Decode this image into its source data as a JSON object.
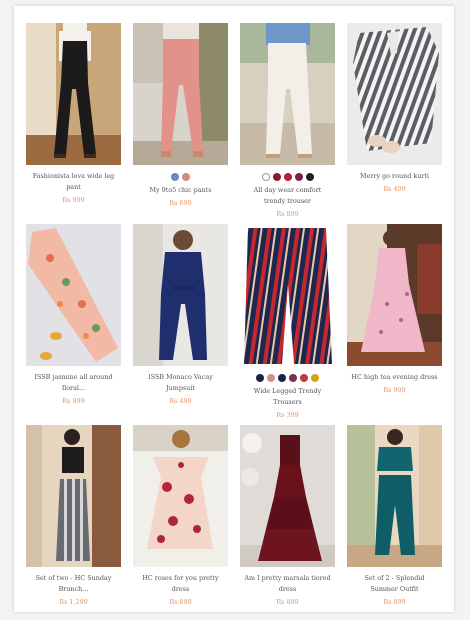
{
  "products": [
    {
      "name": "Fashionista leva wide leg pant",
      "price": "Rs 899",
      "swatches": []
    },
    {
      "name": "My 9to5 chic pants",
      "price": "Rs 699",
      "swatches": [
        "#6f86c6",
        "#cf8b7e"
      ]
    },
    {
      "name": "All day wear comfort trendy trouser",
      "price": "Rs 899",
      "swatches": [
        "#ffffff",
        "#8c1b2b",
        "#b3203a",
        "#7a1f4a",
        "#222222"
      ]
    },
    {
      "name": "Merry go round kurti",
      "price": "Rs 499",
      "swatches": []
    },
    {
      "name": "ISSB jasmine all around floral...",
      "price": "Rs 899",
      "swatches": []
    },
    {
      "name": "ISSB Monaco Vacay Jumpsuit",
      "price": "Rs 499",
      "swatches": []
    },
    {
      "name": "Wide Legged Trendy Trousers",
      "price": "Rs 399",
      "swatches": [
        "#1b2340",
        "#d98c8c",
        "#17254a",
        "#7a2f4a",
        "#c23a3a",
        "#d4a017"
      ]
    },
    {
      "name": "HC high tea evening dress",
      "price": "Rs 999",
      "swatches": []
    },
    {
      "name": "Set of two - HC Sunday Brunch...",
      "price": "Rs 1,299",
      "swatches": []
    },
    {
      "name": "HC roses for you pretty dress",
      "price": "Rs 899",
      "swatches": []
    },
    {
      "name": "Am I pretty marsala tiered dress",
      "price": "Rs 899",
      "swatches": []
    },
    {
      "name": "Set of 2 - Splendid Summer Outfit",
      "price": "Rs 899",
      "swatches": []
    }
  ]
}
